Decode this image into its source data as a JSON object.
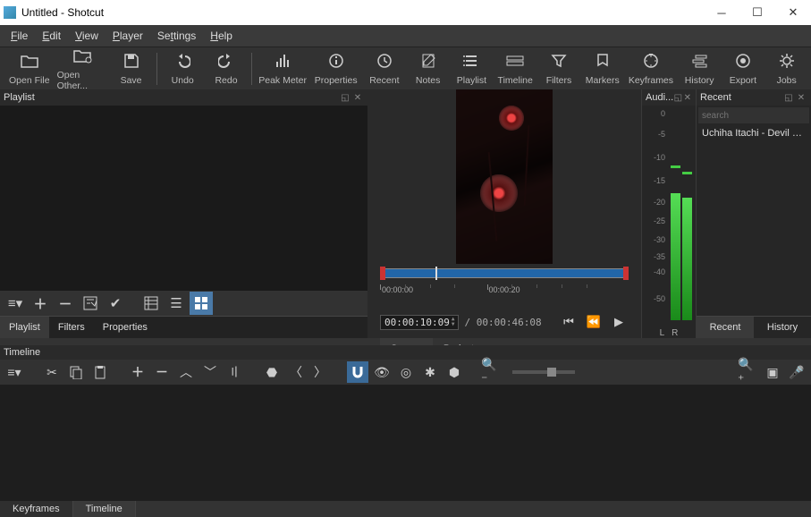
{
  "window": {
    "title": "Untitled - Shotcut"
  },
  "menu": {
    "file": "File",
    "edit": "Edit",
    "view": "View",
    "player": "Player",
    "settings": "Settings",
    "help": "Help"
  },
  "toolbar": [
    {
      "icon": "open",
      "label": "Open File"
    },
    {
      "icon": "open-other",
      "label": "Open Other..."
    },
    {
      "icon": "save",
      "label": "Save"
    },
    {
      "sep": true
    },
    {
      "icon": "undo",
      "label": "Undo"
    },
    {
      "icon": "redo",
      "label": "Redo"
    },
    {
      "sep": true
    },
    {
      "icon": "peak",
      "label": "Peak Meter"
    },
    {
      "icon": "props",
      "label": "Properties"
    },
    {
      "icon": "recent",
      "label": "Recent"
    },
    {
      "icon": "notes",
      "label": "Notes"
    },
    {
      "icon": "playlist",
      "label": "Playlist"
    },
    {
      "icon": "timeline",
      "label": "Timeline"
    },
    {
      "icon": "filters",
      "label": "Filters"
    },
    {
      "icon": "markers",
      "label": "Markers"
    },
    {
      "icon": "keyframes",
      "label": "Keyframes"
    },
    {
      "icon": "history",
      "label": "History"
    },
    {
      "icon": "export",
      "label": "Export"
    },
    {
      "icon": "jobs",
      "label": "Jobs"
    }
  ],
  "playlist": {
    "title": "Playlist",
    "tabs": {
      "playlist": "Playlist",
      "filters": "Filters",
      "properties": "Properties"
    }
  },
  "preview": {
    "timecode": "00:00:10:09",
    "duration": "00:00:46:08",
    "slash": " / ",
    "ruler": {
      "t0": "00:00:00",
      "t1": "00:00:20"
    },
    "tabs": {
      "source": "Source",
      "project": "Project"
    }
  },
  "audio": {
    "title": "Audi...",
    "scale": [
      "0",
      "-5",
      "-10",
      "-15",
      "-20",
      "-25",
      "-30",
      "-35",
      "-40",
      "-50"
    ],
    "l": "L",
    "r": "R"
  },
  "recent": {
    "title": "Recent",
    "search_ph": "search",
    "items": [
      "Uchiha Itachi - Devil Eye..."
    ],
    "tabs": {
      "recent": "Recent",
      "history": "History"
    }
  },
  "timeline": {
    "title": "Timeline",
    "bottom_tabs": {
      "keyframes": "Keyframes",
      "timeline": "Timeline"
    }
  }
}
